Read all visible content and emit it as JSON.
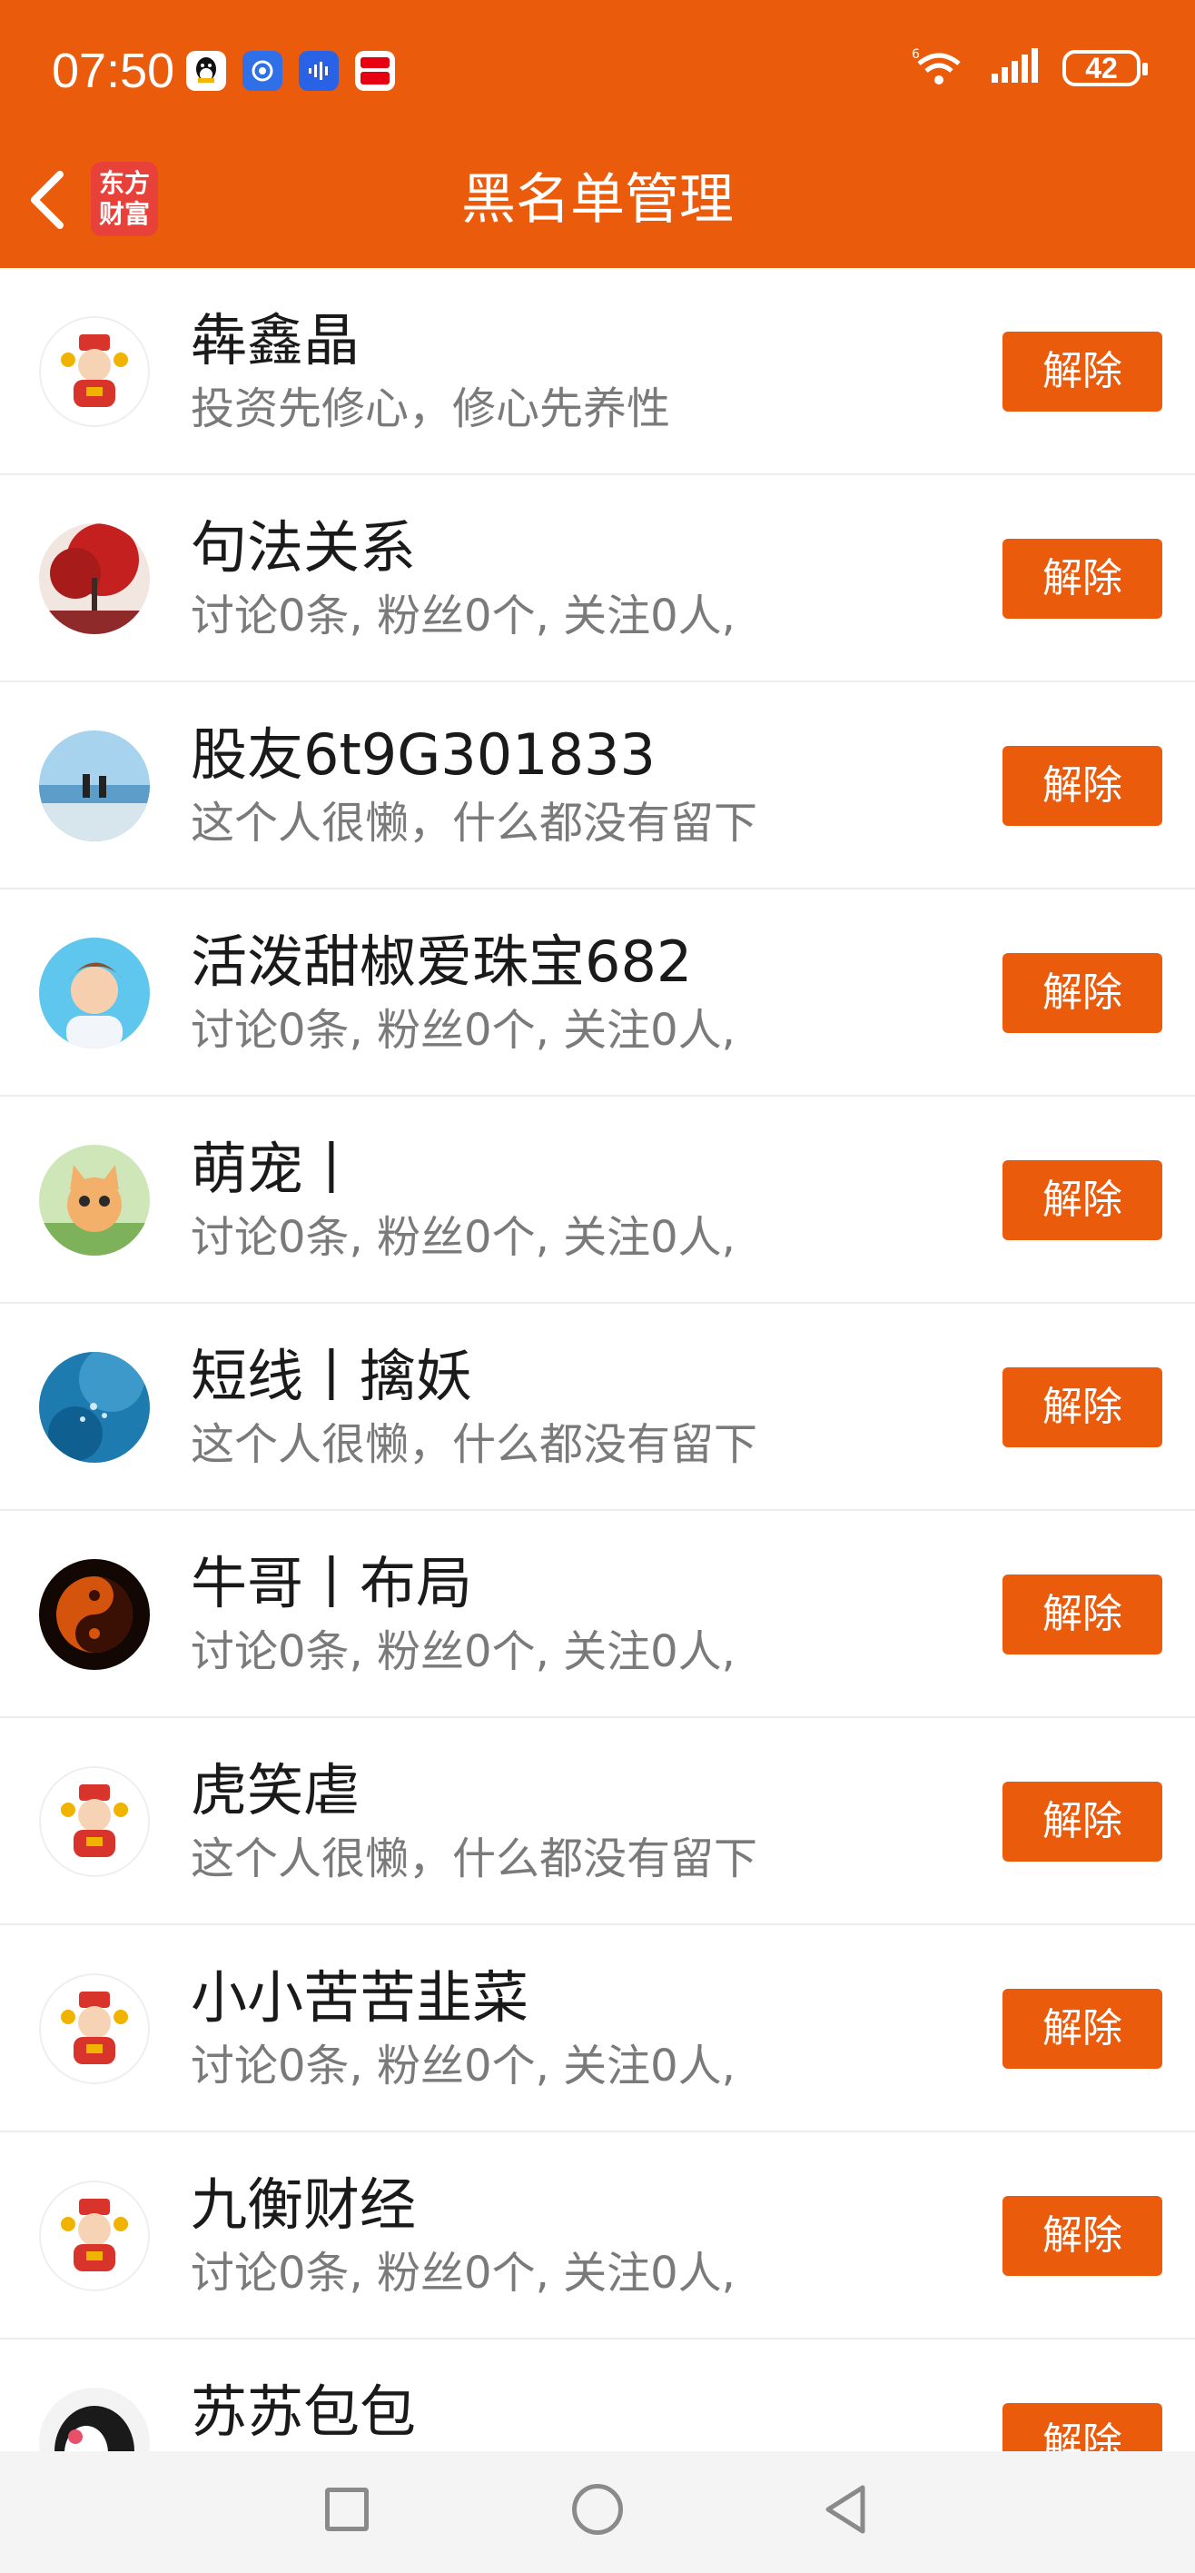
{
  "status_bar": {
    "time": "07:50",
    "app_icons": [
      "qq-icon",
      "assistant-icon",
      "voice-icon",
      "payment-icon"
    ],
    "network": "6",
    "battery": "42"
  },
  "header": {
    "title": "黑名单管理",
    "logo_line1": "东方",
    "logo_line2": "财富",
    "accent_color": "#ea5b0c"
  },
  "blacklist": [
    {
      "name": "犇鑫晶",
      "desc": "投资先修心，修心先养性",
      "avatar": "fortune-god",
      "button": "解除"
    },
    {
      "name": "句法关系",
      "desc": "讨论0条, 粉丝0个, 关注0人,",
      "avatar": "red-tree",
      "button": "解除"
    },
    {
      "name": "股友6t9G301833",
      "desc": "这个人很懒，什么都没有留下",
      "avatar": "beach-couple",
      "button": "解除"
    },
    {
      "name": "活泼甜椒爱珠宝682",
      "desc": "讨论0条, 粉丝0个, 关注0人,",
      "avatar": "cartoon-boy",
      "button": "解除"
    },
    {
      "name": "萌宠丨",
      "desc": "讨论0条, 粉丝0个, 关注0人,",
      "avatar": "kitten",
      "button": "解除"
    },
    {
      "name": "短线丨擒妖",
      "desc": "这个人很懒，什么都没有留下",
      "avatar": "ocean-fish",
      "button": "解除"
    },
    {
      "name": "牛哥丨布局",
      "desc": "讨论0条, 粉丝0个, 关注0人,",
      "avatar": "yin-yang",
      "button": "解除"
    },
    {
      "name": "虎笑虐",
      "desc": "这个人很懒，什么都没有留下",
      "avatar": "fortune-god",
      "button": "解除"
    },
    {
      "name": "小小苦苦韭菜",
      "desc": "讨论0条, 粉丝0个, 关注0人,",
      "avatar": "fortune-god",
      "button": "解除"
    },
    {
      "name": "九衡财经",
      "desc": "讨论0条, 粉丝0个, 关注0人,",
      "avatar": "fortune-god",
      "button": "解除"
    },
    {
      "name": "苏苏包包",
      "desc": "",
      "avatar": "penguin",
      "button": "解除"
    }
  ]
}
